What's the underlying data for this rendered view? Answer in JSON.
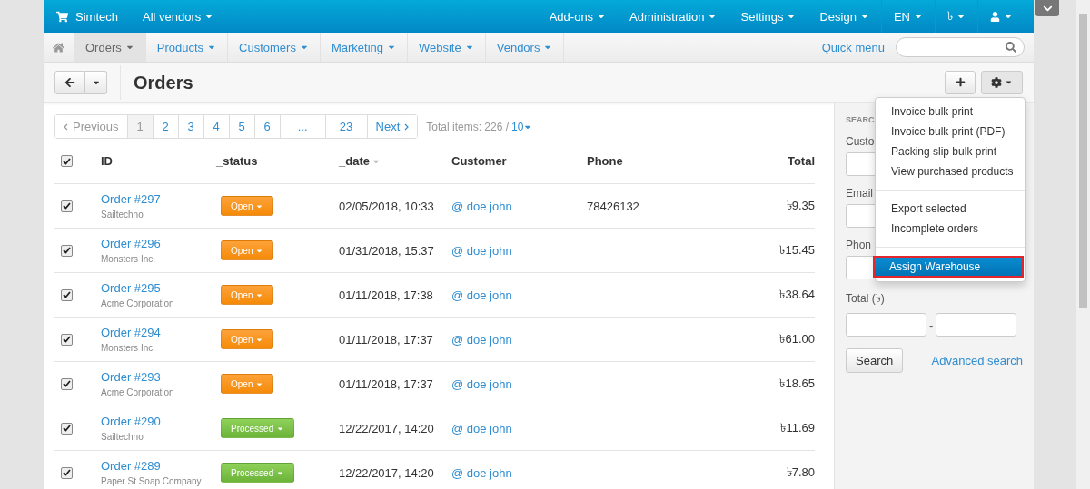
{
  "top_bar": {
    "brand": "Simtech",
    "vendor_menu": "All vendors",
    "menus": [
      {
        "label": "Add-ons"
      },
      {
        "label": "Administration"
      },
      {
        "label": "Settings"
      },
      {
        "label": "Design"
      },
      {
        "label": "EN"
      },
      {
        "label": "৳"
      }
    ]
  },
  "nav": {
    "tabs": [
      {
        "label": "Orders",
        "selected": true
      },
      {
        "label": "Products",
        "selected": false
      },
      {
        "label": "Customers",
        "selected": false
      },
      {
        "label": "Marketing",
        "selected": false
      },
      {
        "label": "Website",
        "selected": false
      },
      {
        "label": "Vendors",
        "selected": false
      }
    ],
    "quick_menu": "Quick menu"
  },
  "page_title": "Orders",
  "pagination": {
    "previous": "Previous",
    "pages": [
      {
        "label": "1",
        "selected": true
      },
      {
        "label": "2",
        "selected": false
      },
      {
        "label": "3",
        "selected": false
      },
      {
        "label": "4",
        "selected": false
      },
      {
        "label": "5",
        "selected": false
      },
      {
        "label": "6",
        "selected": false
      },
      {
        "label": "...",
        "selected": false
      },
      {
        "label": "23",
        "selected": false
      }
    ],
    "next": "Next",
    "total_items": "Total items: 226 /",
    "per_page": "10"
  },
  "table": {
    "all_checked": true,
    "columns": [
      "ID",
      "_status",
      "_date",
      "Customer",
      "Phone",
      "Total"
    ],
    "rows": [
      {
        "checked": true,
        "order": "Order #297",
        "company": "Sailtechno",
        "status": {
          "label": "Open",
          "kind": "open"
        },
        "date": "02/05/2018, 10:33",
        "customer": "@ doe john",
        "phone": "78426132",
        "total": "৳9.35"
      },
      {
        "checked": true,
        "order": "Order #296",
        "company": "Monsters Inc.",
        "status": {
          "label": "Open",
          "kind": "open"
        },
        "date": "01/31/2018, 15:37",
        "customer": "@ doe john",
        "total": "৳15.45"
      },
      {
        "checked": true,
        "order": "Order #295",
        "company": "Acme Corporation",
        "status": {
          "label": "Open",
          "kind": "open"
        },
        "date": "01/11/2018, 17:38",
        "customer": "@ doe john",
        "total": "৳38.64"
      },
      {
        "checked": true,
        "order": "Order #294",
        "company": "Monsters Inc.",
        "status": {
          "label": "Open",
          "kind": "open"
        },
        "date": "01/11/2018, 17:37",
        "customer": "@ doe john",
        "total": "৳61.00"
      },
      {
        "checked": true,
        "order": "Order #293",
        "company": "Acme Corporation",
        "status": {
          "label": "Open",
          "kind": "open"
        },
        "date": "01/11/2018, 17:37",
        "customer": "@ doe john",
        "total": "৳18.65"
      },
      {
        "checked": true,
        "order": "Order #290",
        "company": "Sailtechno",
        "status": {
          "label": "Processed",
          "kind": "processed"
        },
        "date": "12/22/2017, 14:20",
        "customer": "@ doe john",
        "total": "৳11.69"
      },
      {
        "checked": true,
        "order": "Order #289",
        "company": "Paper St Soap Company",
        "status": {
          "label": "Processed",
          "kind": "processed"
        },
        "date": "12/22/2017, 14:20",
        "customer": "@ doe john",
        "total": "৳7.80"
      }
    ]
  },
  "search_panel": {
    "heading": "SEARC",
    "labels": [
      "Custo",
      "Email",
      "Phon"
    ],
    "total_label": "Total (৳)",
    "range_separator": "-",
    "search_button": "Search",
    "advanced_link": "Advanced search"
  },
  "actions_menu": {
    "groups": [
      [
        {
          "label": "Invoice bulk print",
          "selected": false,
          "outlined": false
        },
        {
          "label": "Invoice bulk print (PDF)",
          "selected": false,
          "outlined": false
        },
        {
          "label": "Packing slip bulk print",
          "selected": false,
          "outlined": false
        },
        {
          "label": "View purchased products",
          "selected": false,
          "outlined": false
        }
      ],
      [
        {
          "label": "Export selected",
          "selected": false,
          "outlined": false
        },
        {
          "label": "Incomplete orders",
          "selected": false,
          "outlined": false
        }
      ],
      [
        {
          "label": "Assign Warehouse",
          "selected": true,
          "outlined": true
        }
      ]
    ]
  }
}
